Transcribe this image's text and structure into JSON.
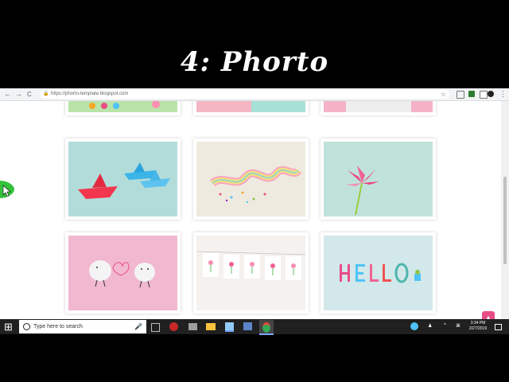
{
  "video": {
    "title": "4: Phorto"
  },
  "browser": {
    "url": "https://phorto-template.blogspot.com",
    "back_glyph": "←",
    "forward_glyph": "→",
    "reload_glyph": "C",
    "lock_glyph": "🔒",
    "star_glyph": "☆",
    "menu_glyph": "⋮"
  },
  "page": {
    "scroll_top_glyph": "▲",
    "accent_color": "#e94d86",
    "photos": [
      {
        "name": "photo-top-left-partial",
        "subject": "colorful craft (partial)"
      },
      {
        "name": "photo-top-middle-partial",
        "subject": "pink and mint blocks (partial)"
      },
      {
        "name": "photo-top-right-partial",
        "subject": "pink block (partial)"
      },
      {
        "name": "photo-paper-boats",
        "subject": "paper boats"
      },
      {
        "name": "photo-rainbow-ribbon",
        "subject": "rainbow ribbon with sprinkles"
      },
      {
        "name": "photo-paper-flower",
        "subject": "origami lily"
      },
      {
        "name": "photo-pebble-characters",
        "subject": "pebble characters"
      },
      {
        "name": "photo-hanging-drawings",
        "subject": "hanging tulip drawings"
      },
      {
        "name": "photo-hello-letters",
        "subject": "HELLO clay letters"
      }
    ]
  },
  "taskbar": {
    "search_placeholder": "Type here to search",
    "time": "3:34 PM",
    "date": "2/27/2019",
    "start_glyph": "⊞",
    "mic_glyph": "🎤"
  }
}
